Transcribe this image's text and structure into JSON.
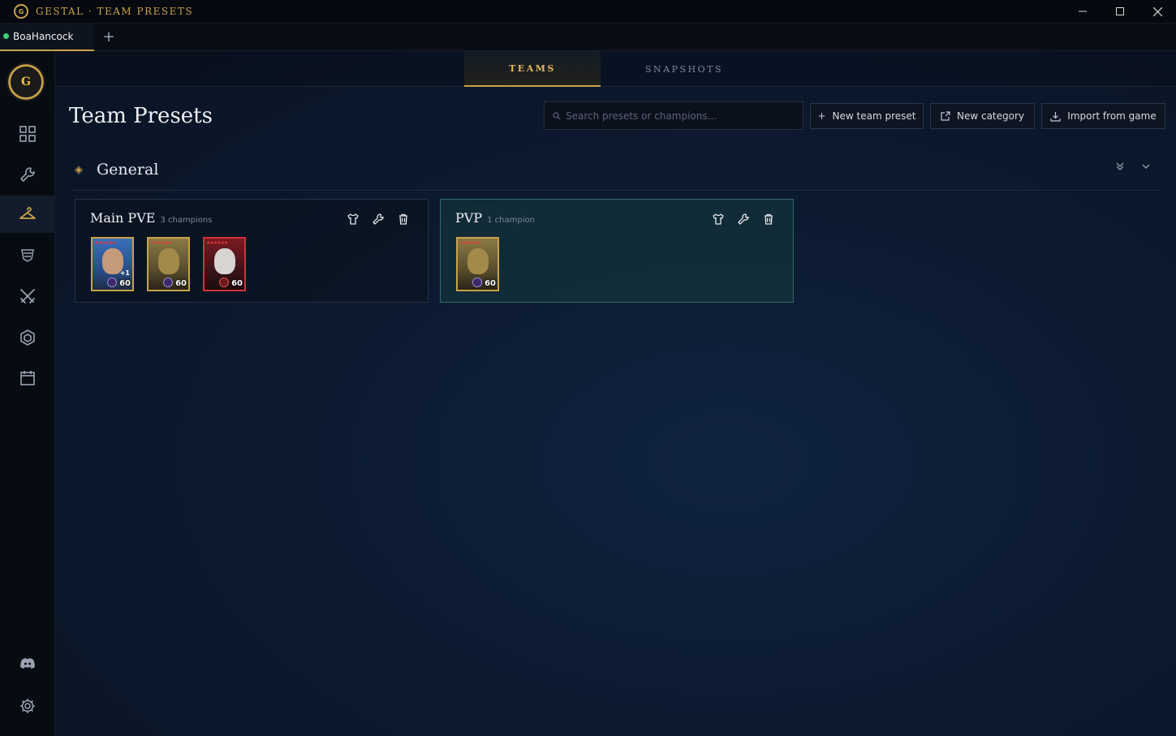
{
  "window": {
    "title": "GESTAL · TEAM PRESETS",
    "logo_letter": "G"
  },
  "account_tab": {
    "name": "BoaHancock",
    "status_color": "#3ecf6f"
  },
  "view_tabs": [
    "TEAMS",
    "SNAPSHOTS"
  ],
  "page": {
    "title": "Team Presets",
    "search_placeholder": "Search presets or champions...",
    "buttons": {
      "new_team_preset": "New team preset",
      "new_category": "New category",
      "import_from_game": "Import from game"
    }
  },
  "sidebar": {
    "items": [
      {
        "icon": "grid-icon"
      },
      {
        "icon": "wrench-icon"
      },
      {
        "icon": "hanger-icon",
        "active": true
      },
      {
        "icon": "artifact-icon"
      },
      {
        "icon": "crossed-swords-icon"
      },
      {
        "icon": "hexagon-icon"
      },
      {
        "icon": "calendar-icon"
      }
    ],
    "bottom": [
      {
        "icon": "discord-icon"
      },
      {
        "icon": "gear-icon"
      }
    ]
  },
  "category": {
    "name": "General",
    "presets": [
      {
        "name": "Main PVE",
        "count": "3 champions",
        "champions": [
          {
            "level": "60",
            "frame": "gold",
            "style": "blue",
            "extra": "+1"
          },
          {
            "level": "60",
            "frame": "gold",
            "style": "gold"
          },
          {
            "level": "60",
            "frame": "red",
            "style": "red"
          }
        ]
      },
      {
        "name": "PVP",
        "count": "1 champion",
        "selected": true,
        "champions": [
          {
            "level": "60",
            "frame": "gold",
            "style": "gold"
          }
        ]
      }
    ]
  },
  "colors": {
    "accent_gold": "#c8a24a",
    "selected_card": "#1c4a4c",
    "background": "#0c1a30"
  }
}
